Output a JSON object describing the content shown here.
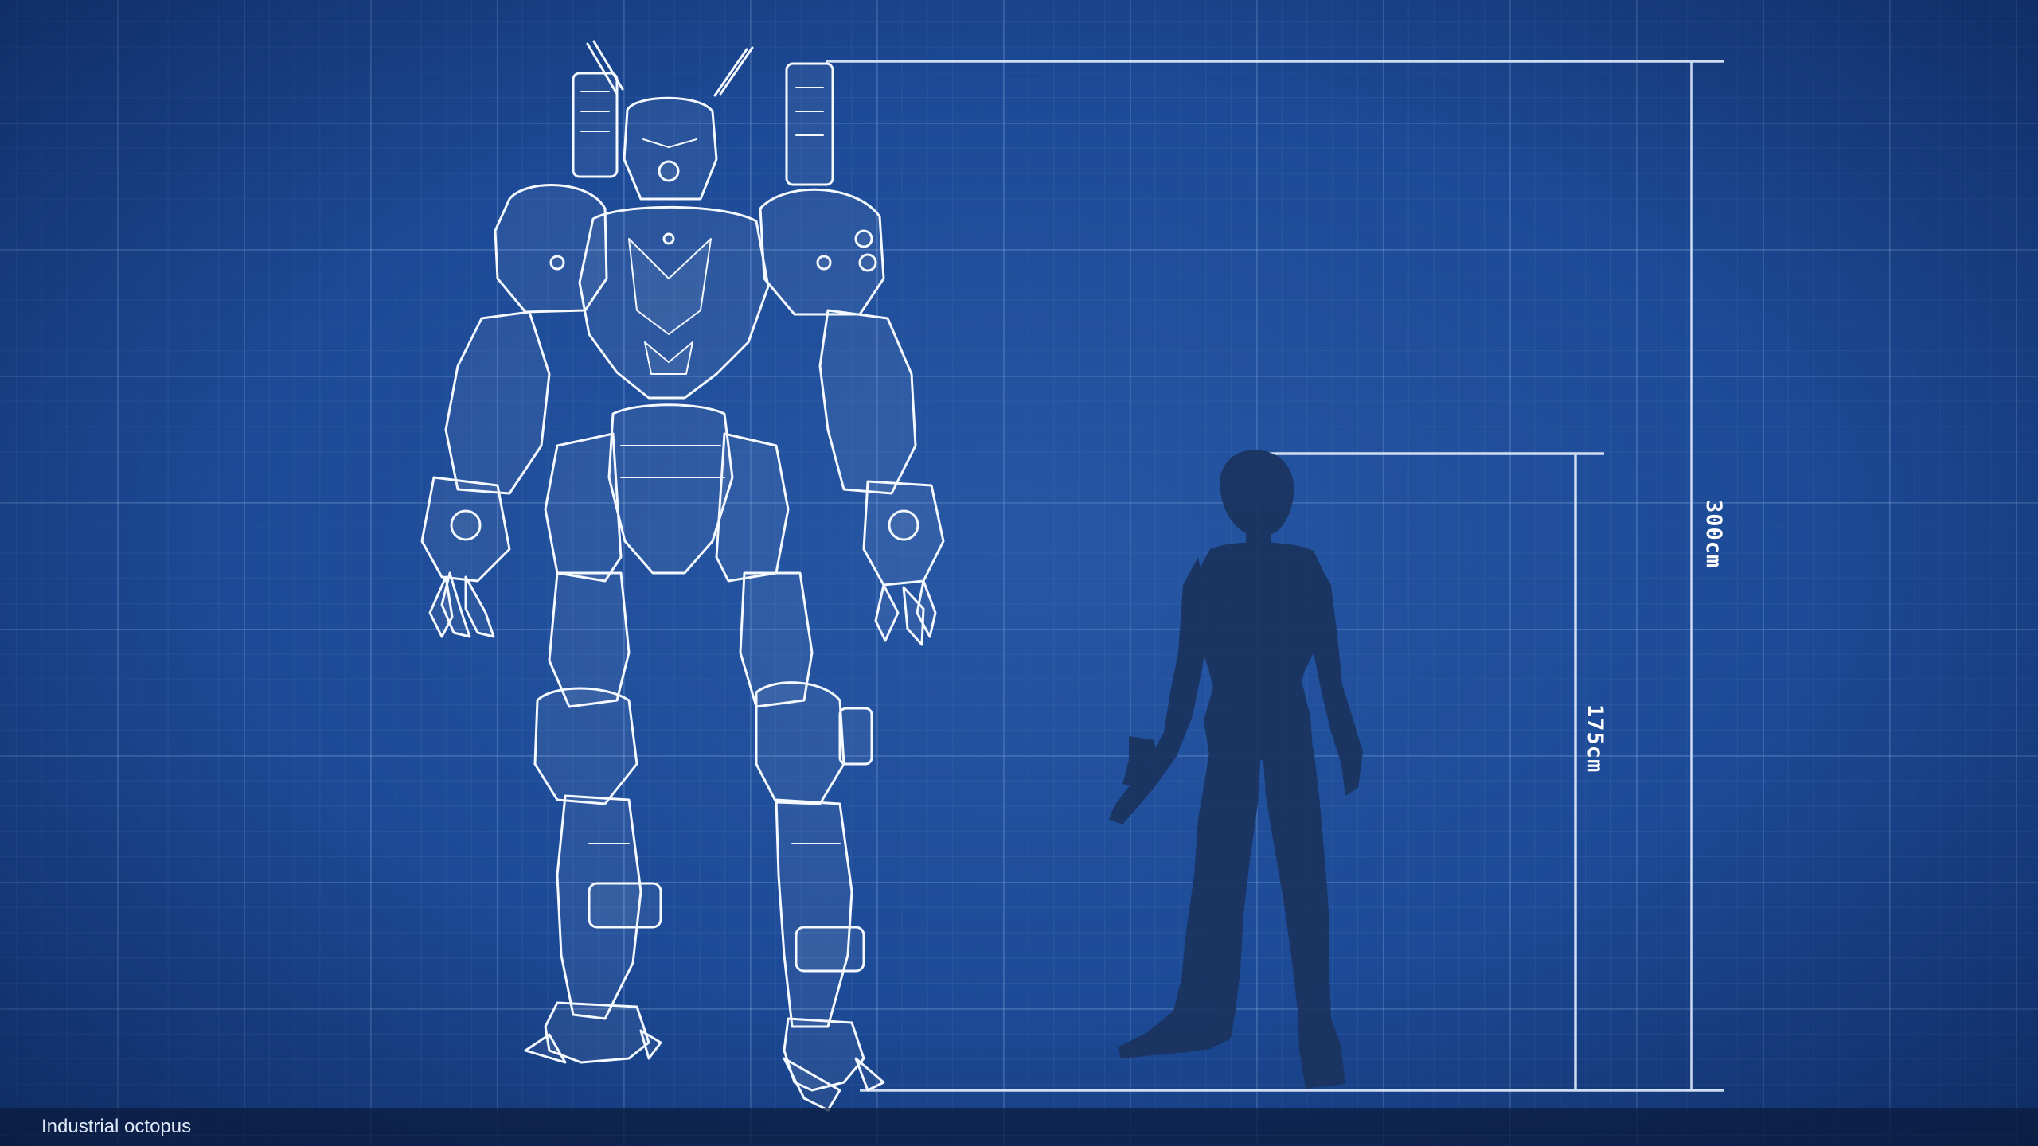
{
  "caption": "Industrial octopus",
  "dimensions": {
    "robot_height": "300cm",
    "human_height": "175cm"
  },
  "colors": {
    "background": "#1c4a96",
    "grid": "#96b9eb",
    "lineart": "#ffffff",
    "silhouette": "#1b335e"
  },
  "figures": {
    "robot": "robot-mech-lineart",
    "human": "human-silhouette"
  }
}
